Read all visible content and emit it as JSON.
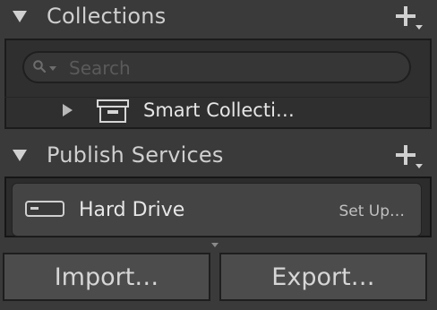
{
  "collections": {
    "title": "Collections",
    "add_icon": "plus-icon",
    "search": {
      "placeholder": "Search",
      "value": ""
    },
    "items": [
      {
        "label": "Smart Collecti…",
        "icon": "smart-collection-set-icon",
        "expanded": false
      }
    ]
  },
  "publish_services": {
    "title": "Publish Services",
    "add_icon": "plus-icon",
    "services": [
      {
        "label": "Hard Drive",
        "action": "Set Up…",
        "icon": "hard-drive-icon"
      }
    ]
  },
  "buttons": {
    "import": "Import…",
    "export": "Export…"
  },
  "colors": {
    "background": "#3a3a3a",
    "panel": "#2f2f2f",
    "text": "#cfcfcf",
    "button": "#4c4c4c"
  }
}
